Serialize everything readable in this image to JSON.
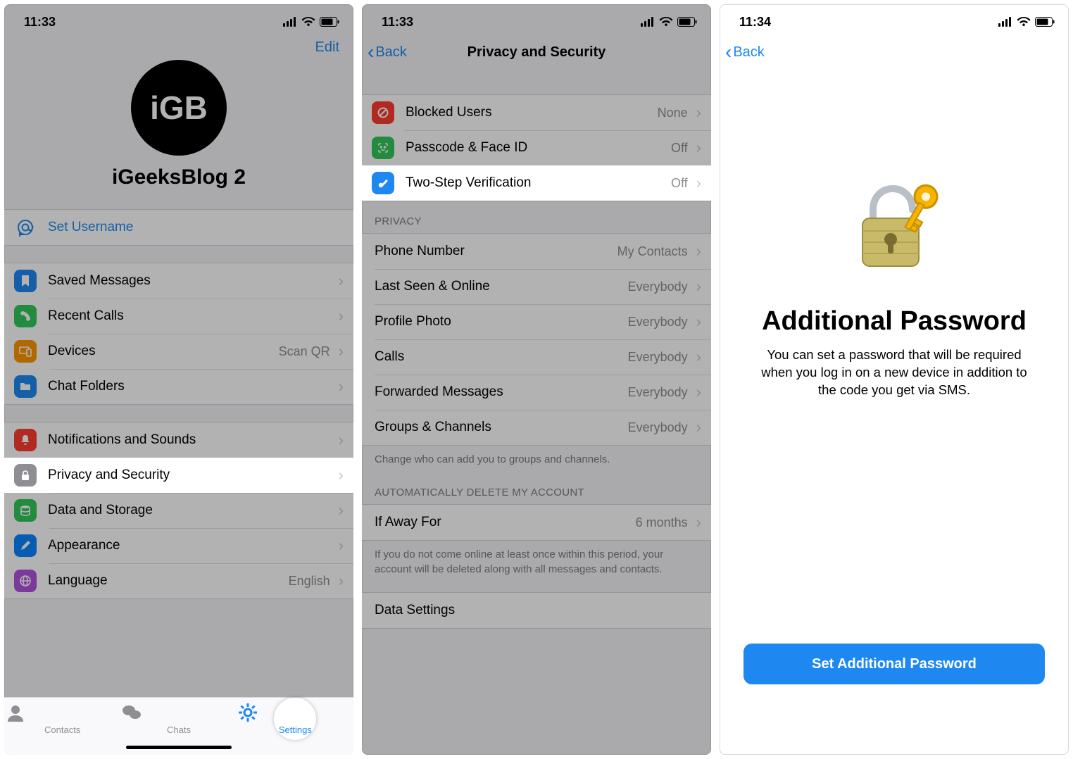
{
  "screen1": {
    "time": "11:33",
    "edit": "Edit",
    "avatar_text": "iGB",
    "profile_name": "iGeeksBlog 2",
    "set_username": "Set Username",
    "rows": {
      "saved_messages": "Saved Messages",
      "recent_calls": "Recent Calls",
      "devices": "Devices",
      "devices_detail": "Scan QR",
      "chat_folders": "Chat Folders",
      "notifications": "Notifications and Sounds",
      "privacy": "Privacy and Security",
      "data": "Data and Storage",
      "appearance": "Appearance",
      "language": "Language",
      "language_detail": "English"
    },
    "tabs": {
      "contacts": "Contacts",
      "chats": "Chats",
      "settings": "Settings"
    }
  },
  "screen2": {
    "time": "11:33",
    "back": "Back",
    "title": "Privacy and Security",
    "blocked": "Blocked Users",
    "blocked_detail": "None",
    "passcode": "Passcode & Face ID",
    "passcode_detail": "Off",
    "twostep": "Two-Step Verification",
    "twostep_detail": "Off",
    "privacy_header": "PRIVACY",
    "phone": "Phone Number",
    "phone_detail": "My Contacts",
    "lastseen": "Last Seen & Online",
    "lastseen_detail": "Everybody",
    "photo": "Profile Photo",
    "photo_detail": "Everybody",
    "calls": "Calls",
    "calls_detail": "Everybody",
    "forwarded": "Forwarded Messages",
    "forwarded_detail": "Everybody",
    "groups": "Groups & Channels",
    "groups_detail": "Everybody",
    "groups_footer": "Change who can add you to groups and channels.",
    "auto_header": "AUTOMATICALLY DELETE MY ACCOUNT",
    "away": "If Away For",
    "away_detail": "6 months",
    "away_footer": "If you do not come online at least once within this period, your account will be deleted along with all messages and contacts.",
    "data_settings": "Data Settings"
  },
  "screen3": {
    "time": "11:34",
    "back": "Back",
    "title": "Additional Password",
    "desc": "You can set a password that will be required when you log in on a new device in addition to the code you get via SMS.",
    "cta": "Set Additional Password"
  }
}
